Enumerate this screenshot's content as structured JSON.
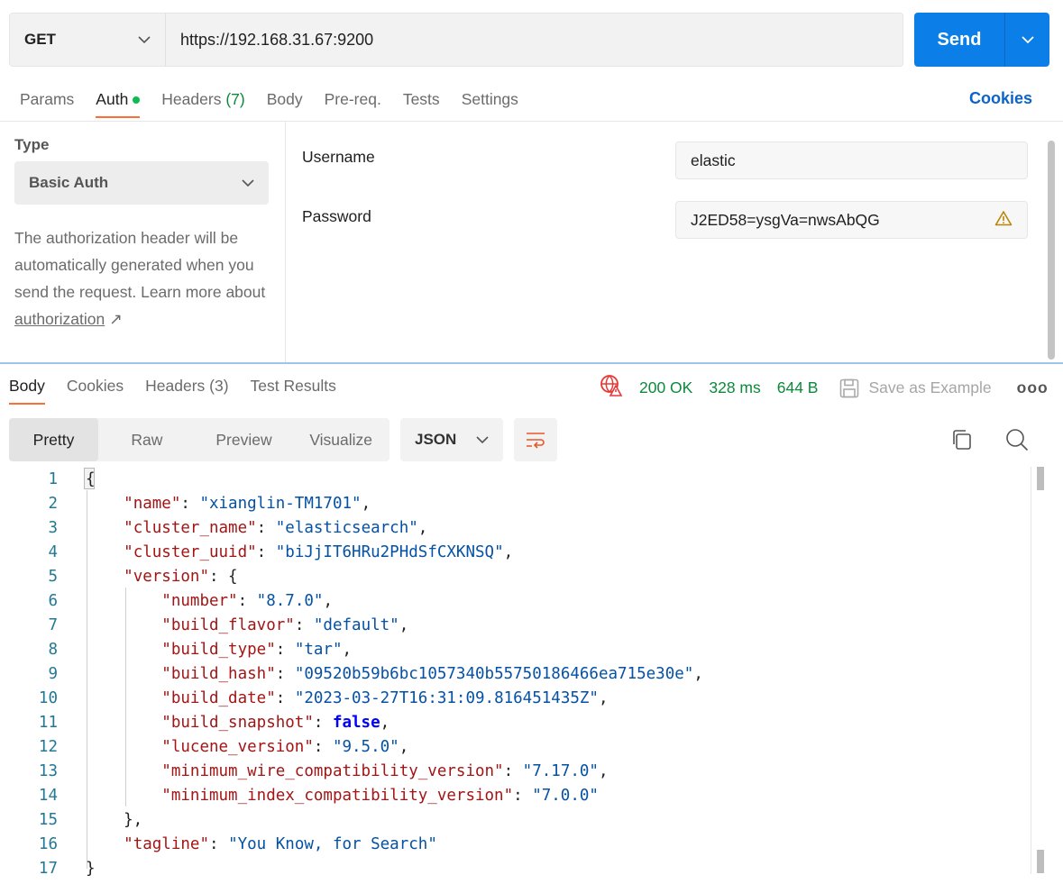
{
  "request": {
    "method": "GET",
    "url": "https://192.168.31.67:9200",
    "send_label": "Send"
  },
  "req_tabs": [
    {
      "label": "Params"
    },
    {
      "label": "Auth",
      "active": true,
      "dot": true
    },
    {
      "label": "Headers",
      "count": "(7)"
    },
    {
      "label": "Body"
    },
    {
      "label": "Pre-req."
    },
    {
      "label": "Tests"
    },
    {
      "label": "Settings"
    }
  ],
  "cookies_label": "Cookies",
  "auth": {
    "type_label": "Type",
    "type_value": "Basic Auth",
    "desc_prefix": "The authorization header will be automatically generated when you send the request. Learn more about ",
    "desc_link": "authorization",
    "desc_arrow": "↗",
    "username_label": "Username",
    "username_value": "elastic",
    "password_label": "Password",
    "password_value": "J2ED58=ysgVa=nwsAbQG"
  },
  "res_tabs": [
    {
      "label": "Body",
      "active": true
    },
    {
      "label": "Cookies"
    },
    {
      "label": "Headers (3)"
    },
    {
      "label": "Test Results"
    }
  ],
  "status": {
    "code": "200 OK",
    "time": "328 ms",
    "size": "644 B",
    "save_label": "Save as Example",
    "more": "ooo",
    "colors": {
      "ok": "#0b8a3a",
      "warn": "#e53935"
    }
  },
  "view_tabs": [
    {
      "label": "Pretty",
      "active": true
    },
    {
      "label": "Raw"
    },
    {
      "label": "Preview"
    },
    {
      "label": "Visualize"
    }
  ],
  "format": "JSON",
  "code_lines": [
    [
      [
        "p",
        "{"
      ]
    ],
    [
      [
        "p",
        "    "
      ],
      [
        "k",
        "\"name\""
      ],
      [
        "p",
        ": "
      ],
      [
        "s",
        "\"xianglin-TM1701\""
      ],
      [
        "p",
        ","
      ]
    ],
    [
      [
        "p",
        "    "
      ],
      [
        "k",
        "\"cluster_name\""
      ],
      [
        "p",
        ": "
      ],
      [
        "s",
        "\"elasticsearch\""
      ],
      [
        "p",
        ","
      ]
    ],
    [
      [
        "p",
        "    "
      ],
      [
        "k",
        "\"cluster_uuid\""
      ],
      [
        "p",
        ": "
      ],
      [
        "s",
        "\"biJjIT6HRu2PHdSfCXKNSQ\""
      ],
      [
        "p",
        ","
      ]
    ],
    [
      [
        "p",
        "    "
      ],
      [
        "k",
        "\"version\""
      ],
      [
        "p",
        ": {"
      ]
    ],
    [
      [
        "p",
        "        "
      ],
      [
        "k",
        "\"number\""
      ],
      [
        "p",
        ": "
      ],
      [
        "s",
        "\"8.7.0\""
      ],
      [
        "p",
        ","
      ]
    ],
    [
      [
        "p",
        "        "
      ],
      [
        "k",
        "\"build_flavor\""
      ],
      [
        "p",
        ": "
      ],
      [
        "s",
        "\"default\""
      ],
      [
        "p",
        ","
      ]
    ],
    [
      [
        "p",
        "        "
      ],
      [
        "k",
        "\"build_type\""
      ],
      [
        "p",
        ": "
      ],
      [
        "s",
        "\"tar\""
      ],
      [
        "p",
        ","
      ]
    ],
    [
      [
        "p",
        "        "
      ],
      [
        "k",
        "\"build_hash\""
      ],
      [
        "p",
        ": "
      ],
      [
        "s",
        "\"09520b59b6bc1057340b55750186466ea715e30e\""
      ],
      [
        "p",
        ","
      ]
    ],
    [
      [
        "p",
        "        "
      ],
      [
        "k",
        "\"build_date\""
      ],
      [
        "p",
        ": "
      ],
      [
        "s",
        "\"2023-03-27T16:31:09.816451435Z\""
      ],
      [
        "p",
        ","
      ]
    ],
    [
      [
        "p",
        "        "
      ],
      [
        "k",
        "\"build_snapshot\""
      ],
      [
        "p",
        ": "
      ],
      [
        "b",
        "false"
      ],
      [
        "p",
        ","
      ]
    ],
    [
      [
        "p",
        "        "
      ],
      [
        "k",
        "\"lucene_version\""
      ],
      [
        "p",
        ": "
      ],
      [
        "s",
        "\"9.5.0\""
      ],
      [
        "p",
        ","
      ]
    ],
    [
      [
        "p",
        "        "
      ],
      [
        "k",
        "\"minimum_wire_compatibility_version\""
      ],
      [
        "p",
        ": "
      ],
      [
        "s",
        "\"7.17.0\""
      ],
      [
        "p",
        ","
      ]
    ],
    [
      [
        "p",
        "        "
      ],
      [
        "k",
        "\"minimum_index_compatibility_version\""
      ],
      [
        "p",
        ": "
      ],
      [
        "s",
        "\"7.0.0\""
      ]
    ],
    [
      [
        "p",
        "    },"
      ]
    ],
    [
      [
        "p",
        "    "
      ],
      [
        "k",
        "\"tagline\""
      ],
      [
        "p",
        ": "
      ],
      [
        "s",
        "\"You Know, for Search\""
      ]
    ],
    [
      [
        "p",
        "}"
      ]
    ]
  ]
}
